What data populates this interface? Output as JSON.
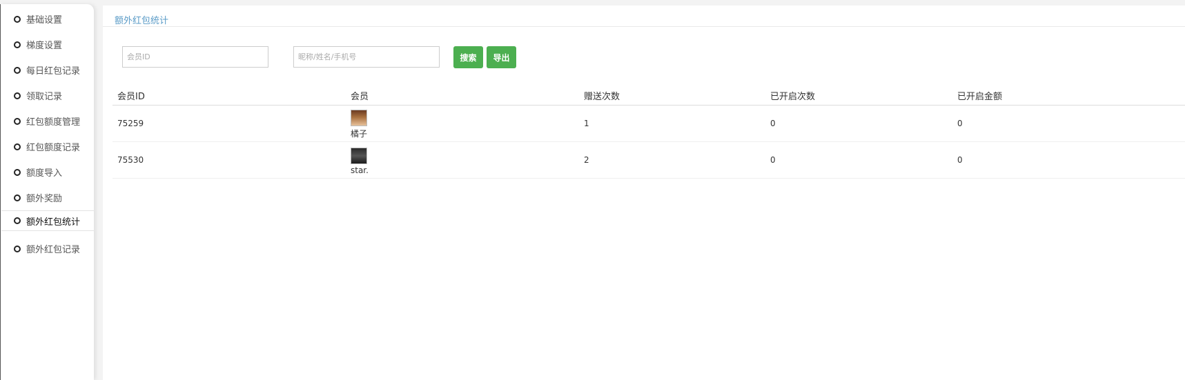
{
  "sidebar": {
    "items": [
      {
        "label": "基础设置"
      },
      {
        "label": "梯度设置"
      },
      {
        "label": "每日红包记录"
      },
      {
        "label": "领取记录"
      },
      {
        "label": "红包额度管理"
      },
      {
        "label": "红包额度记录"
      },
      {
        "label": "额度导入"
      },
      {
        "label": "额外奖励"
      },
      {
        "label": "额外红包统计",
        "active": true
      },
      {
        "label": "额外红包记录"
      }
    ]
  },
  "page": {
    "title": "额外红包统计"
  },
  "search": {
    "member_id_placeholder": "会员ID",
    "name_phone_placeholder": "昵称/姓名/手机号",
    "search_label": "搜索",
    "export_label": "导出"
  },
  "table": {
    "headers": [
      "会员ID",
      "会员",
      "赠送次数",
      "已开启次数",
      "已开启金额"
    ],
    "rows": [
      {
        "member_id": "75259",
        "member_name": "橘子",
        "gift_count": "1",
        "opened_count": "0",
        "opened_amount": "0"
      },
      {
        "member_id": "75530",
        "member_name": "star.",
        "gift_count": "2",
        "opened_count": "0",
        "opened_amount": "0"
      }
    ]
  },
  "colors": {
    "accent": "#4caf50",
    "title": "#5a9bc7"
  }
}
